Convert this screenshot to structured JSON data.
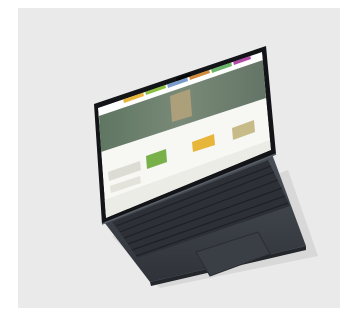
{
  "scene": {
    "subject": "laptop-mockup",
    "background_color": "#eaeaea",
    "laptop_body_color": "#3f434a",
    "screen_bezel_color": "#121417",
    "website_header_colors": [
      "#e7b53a",
      "#8bbf3f",
      "#7a9cc8",
      "#d08a3a",
      "#6bb36a",
      "#b14aa4",
      "#4a74c9"
    ],
    "website_hero_color": "#6d7f6f",
    "website_content_color": "#f7f7f3"
  }
}
